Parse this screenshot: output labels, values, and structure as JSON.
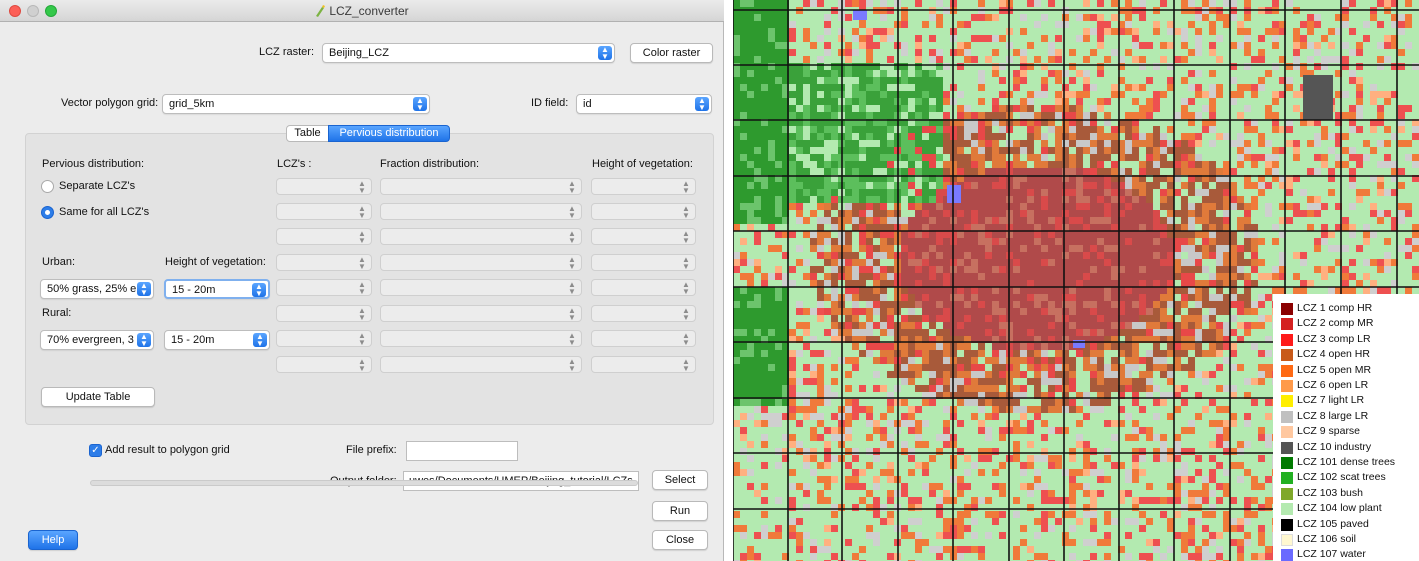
{
  "window": {
    "title": "LCZ_converter"
  },
  "top": {
    "lcz_raster_label": "LCZ raster:",
    "lcz_raster_value": "Beijing_LCZ",
    "color_raster_button": "Color raster",
    "vector_grid_label": "Vector polygon grid:",
    "vector_grid_value": "grid_5km",
    "id_field_label": "ID field:",
    "id_field_value": "id"
  },
  "tabs": {
    "table": "Table",
    "pervious": "Pervious distribution"
  },
  "pervious": {
    "heading": "Pervious distribution:",
    "option_separate": "Separate LCZ's",
    "option_same": "Same for all LCZ's",
    "selected_option": "same",
    "urban_label": "Urban:",
    "height_label": "Height of vegetation:",
    "urban_value": "50% grass, 25% е",
    "urban_height": "15 - 20m",
    "rural_label": "Rural:",
    "rural_value": "70% evergreen, 3",
    "rural_height": "15 - 20m",
    "update_button": "Update Table"
  },
  "grid_headers": {
    "lczs": "LCZ's :",
    "fraction": "Fraction distribution:",
    "height": "Height of vegetation:"
  },
  "bottom": {
    "add_result_label": "Add result to polygon grid",
    "add_result_checked": true,
    "file_prefix_label": "File prefix:",
    "file_prefix_value": "",
    "output_folder_label": "Output folder:",
    "output_folder_value": "uwes/Documents/UMEP/Beijing_tutorial/LCZs",
    "select_button": "Select",
    "run_button": "Run",
    "close_button": "Close",
    "help_button": "Help"
  },
  "colors": {
    "accent": "#2d7de8"
  },
  "legend": [
    {
      "label": "LCZ 1 comp HR",
      "color": "#8b0000"
    },
    {
      "label": "LCZ 2 comp MR",
      "color": "#d42020"
    },
    {
      "label": "LCZ 3 comp LR",
      "color": "#ff1a1a"
    },
    {
      "label": "LCZ 4 open HR",
      "color": "#c85a1a"
    },
    {
      "label": "LCZ 5 open MR",
      "color": "#ff6a14"
    },
    {
      "label": "LCZ 6 open LR",
      "color": "#ff9a4a"
    },
    {
      "label": "LCZ 7 light LR",
      "color": "#ffee00"
    },
    {
      "label": "LCZ 8 large LR",
      "color": "#c0c0c0"
    },
    {
      "label": "LCZ 9 sparse",
      "color": "#ffc8a0"
    },
    {
      "label": "LCZ 10 industry",
      "color": "#555555"
    },
    {
      "label": "LCZ 101 dense trees",
      "color": "#007a00"
    },
    {
      "label": "LCZ 102 scat trees",
      "color": "#22b022"
    },
    {
      "label": "LCZ 103 bush",
      "color": "#7fa82a"
    },
    {
      "label": "LCZ 104 low plant",
      "color": "#b4eab0"
    },
    {
      "label": "LCZ 105 paved",
      "color": "#000000"
    },
    {
      "label": "LCZ 106 soil",
      "color": "#fff8d0"
    },
    {
      "label": "LCZ 107 water",
      "color": "#6a6aff"
    }
  ]
}
